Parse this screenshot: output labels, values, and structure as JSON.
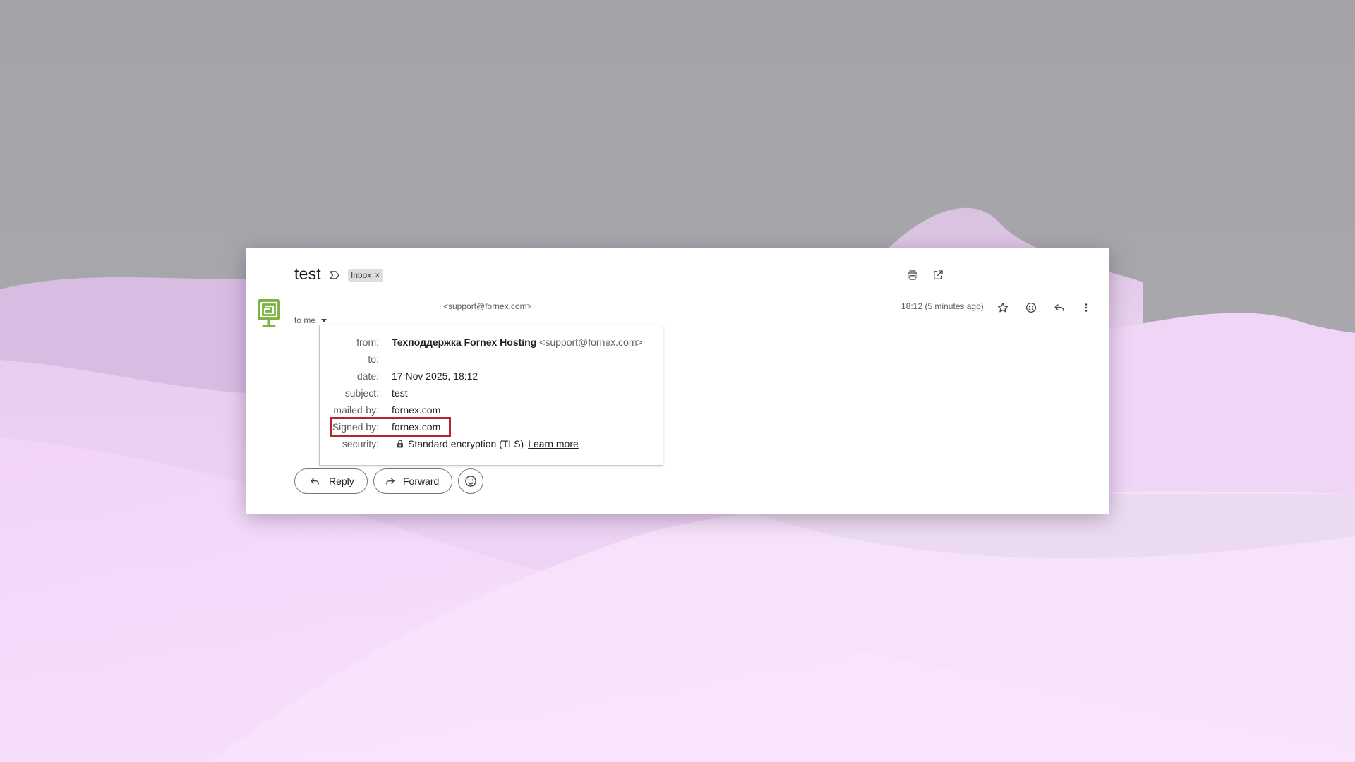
{
  "email": {
    "subject": "test",
    "label_chip": "Inbox",
    "label_chip_remove": "×",
    "sender_email_header": "<support@fornex.com>",
    "recipient_summary": "to me",
    "timestamp": "18:12 (5 minutes ago)"
  },
  "header_actions": {
    "icons": [
      "print-icon",
      "open-in-new-window-icon"
    ]
  },
  "message_actions": {
    "icons": [
      "star-icon",
      "emoji-icon",
      "reply-icon",
      "more-vertical-icon"
    ]
  },
  "details": {
    "from_label": "from:",
    "from_name": "Техподдержка Fornex Hosting",
    "from_email": "<support@fornex.com>",
    "to_label": "to:",
    "to_value": "",
    "date_label": "date:",
    "date_value": "17 Nov 2025, 18:12",
    "subject_label": "subject:",
    "subject_value": "test",
    "mailed_by_label": "mailed-by:",
    "mailed_by_value": "fornex.com",
    "signed_by_label": "Signed by:",
    "signed_by_value": "fornex.com",
    "security_label": "security:",
    "security_value": "Standard encryption (TLS)",
    "security_link": "Learn more"
  },
  "footer_buttons": {
    "reply_label": "Reply",
    "forward_label": "Forward"
  },
  "colors": {
    "highlight": "#b3262d",
    "avatar": "#7cb342"
  }
}
